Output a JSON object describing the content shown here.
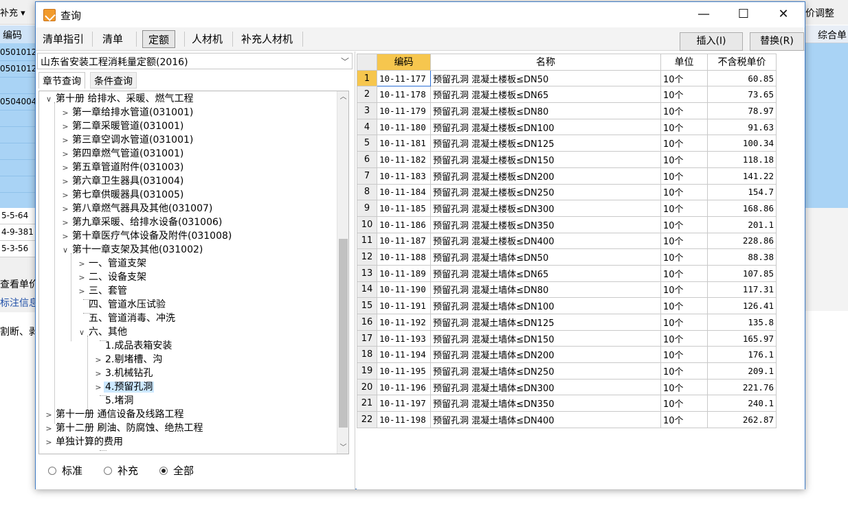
{
  "background": {
    "supplement_menu": "补充 ▾",
    "code_header": "编码",
    "codes": [
      "0501012",
      "0501012",
      "0504004"
    ],
    "white_rows": [
      "5-5-64",
      "4-9-381",
      "5-3-56"
    ],
    "texts": [
      "查看单价",
      "标注信息",
      "割断、剥"
    ],
    "right_label": "价调整",
    "right_header": "综合单"
  },
  "dialog": {
    "title": "查询",
    "window_buttons": {
      "minimize": "—",
      "maximize": "☐",
      "close": "✕"
    },
    "tabs": [
      {
        "label": "清单指引",
        "active": false
      },
      {
        "label": "清单",
        "active": false
      },
      {
        "label": "定额",
        "active": true
      },
      {
        "label": "人材机",
        "active": false
      },
      {
        "label": "补充人材机",
        "active": false
      }
    ],
    "buttons": {
      "insert": "插入(I)",
      "replace": "替换(R)"
    },
    "quota_library": "山东省安装工程消耗量定额(2016)",
    "subtabs": {
      "chapter": "章节查询",
      "condition": "条件查询"
    },
    "tree": [
      {
        "label": "第十册 给排水、采暖、燃气工程",
        "toggle": "expanded"
      },
      {
        "label": "第一章给排水管道(031001)",
        "toggle": "collapsed"
      },
      {
        "label": "第二章采暖管道(031001)",
        "toggle": "collapsed"
      },
      {
        "label": "第三章空调水管道(031001)",
        "toggle": "collapsed"
      },
      {
        "label": "第四章燃气管道(031001)",
        "toggle": "collapsed"
      },
      {
        "label": "第五章管道附件(031003)",
        "toggle": "collapsed"
      },
      {
        "label": "第六章卫生器具(031004)",
        "toggle": "collapsed"
      },
      {
        "label": "第七章供暖器具(031005)",
        "toggle": "collapsed"
      },
      {
        "label": "第八章燃气器具及其他(031007)",
        "toggle": "collapsed"
      },
      {
        "label": "第九章采暖、给排水设备(031006)",
        "toggle": "collapsed"
      },
      {
        "label": "第十章医疗气体设备及附件(031008)",
        "toggle": "collapsed"
      },
      {
        "label": "第十一章支架及其他(031002)",
        "toggle": "expanded"
      },
      {
        "label": "一、管道支架",
        "toggle": "collapsed"
      },
      {
        "label": "二、设备支架",
        "toggle": "collapsed"
      },
      {
        "label": "三、套管",
        "toggle": "collapsed"
      },
      {
        "label": "四、管道水压试验",
        "toggle": "none"
      },
      {
        "label": "五、管道消毒、冲洗",
        "toggle": "none"
      },
      {
        "label": "六、其他",
        "toggle": "expanded"
      },
      {
        "label": "1.成品表箱安装",
        "toggle": "none"
      },
      {
        "label": "2.剔堵槽、沟",
        "toggle": "collapsed"
      },
      {
        "label": "3.机械钻孔",
        "toggle": "collapsed"
      },
      {
        "label": "4.预留孔洞",
        "toggle": "collapsed",
        "selected": true
      },
      {
        "label": "5.堵洞",
        "toggle": "none"
      },
      {
        "label": "第十一册 通信设备及线路工程",
        "toggle": "collapsed"
      },
      {
        "label": "第十二册 刷油、防腐蚀、绝热工程",
        "toggle": "collapsed"
      },
      {
        "label": "单独计算的费用",
        "toggle": "collapsed"
      }
    ],
    "filters": [
      {
        "label": "标准",
        "checked": false
      },
      {
        "label": "补充",
        "checked": false
      },
      {
        "label": "全部",
        "checked": true
      }
    ],
    "table": {
      "columns": [
        "编码",
        "名称",
        "单位",
        "不含税单价"
      ],
      "rows": [
        {
          "no": "1",
          "code": "10-11-177",
          "name": "预留孔洞 混凝土楼板≤DN50",
          "unit": "10个",
          "price": "60.85"
        },
        {
          "no": "2",
          "code": "10-11-178",
          "name": "预留孔洞 混凝土楼板≤DN65",
          "unit": "10个",
          "price": "73.65"
        },
        {
          "no": "3",
          "code": "10-11-179",
          "name": "预留孔洞 混凝土楼板≤DN80",
          "unit": "10个",
          "price": "78.97"
        },
        {
          "no": "4",
          "code": "10-11-180",
          "name": "预留孔洞 混凝土楼板≤DN100",
          "unit": "10个",
          "price": "91.63"
        },
        {
          "no": "5",
          "code": "10-11-181",
          "name": "预留孔洞 混凝土楼板≤DN125",
          "unit": "10个",
          "price": "100.34"
        },
        {
          "no": "6",
          "code": "10-11-182",
          "name": "预留孔洞 混凝土楼板≤DN150",
          "unit": "10个",
          "price": "118.18"
        },
        {
          "no": "7",
          "code": "10-11-183",
          "name": "预留孔洞 混凝土楼板≤DN200",
          "unit": "10个",
          "price": "141.22"
        },
        {
          "no": "8",
          "code": "10-11-184",
          "name": "预留孔洞 混凝土楼板≤DN250",
          "unit": "10个",
          "price": "154.7"
        },
        {
          "no": "9",
          "code": "10-11-185",
          "name": "预留孔洞 混凝土楼板≤DN300",
          "unit": "10个",
          "price": "168.86"
        },
        {
          "no": "10",
          "code": "10-11-186",
          "name": "预留孔洞 混凝土楼板≤DN350",
          "unit": "10个",
          "price": "201.1"
        },
        {
          "no": "11",
          "code": "10-11-187",
          "name": "预留孔洞 混凝土楼板≤DN400",
          "unit": "10个",
          "price": "228.86"
        },
        {
          "no": "12",
          "code": "10-11-188",
          "name": "预留孔洞 混凝土墙体≤DN50",
          "unit": "10个",
          "price": "88.38"
        },
        {
          "no": "13",
          "code": "10-11-189",
          "name": "预留孔洞 混凝土墙体≤DN65",
          "unit": "10个",
          "price": "107.85"
        },
        {
          "no": "14",
          "code": "10-11-190",
          "name": "预留孔洞 混凝土墙体≤DN80",
          "unit": "10个",
          "price": "117.31"
        },
        {
          "no": "15",
          "code": "10-11-191",
          "name": "预留孔洞 混凝土墙体≤DN100",
          "unit": "10个",
          "price": "126.41"
        },
        {
          "no": "16",
          "code": "10-11-192",
          "name": "预留孔洞 混凝土墙体≤DN125",
          "unit": "10个",
          "price": "135.8"
        },
        {
          "no": "17",
          "code": "10-11-193",
          "name": "预留孔洞 混凝土墙体≤DN150",
          "unit": "10个",
          "price": "165.97"
        },
        {
          "no": "18",
          "code": "10-11-194",
          "name": "预留孔洞 混凝土墙体≤DN200",
          "unit": "10个",
          "price": "176.1"
        },
        {
          "no": "19",
          "code": "10-11-195",
          "name": "预留孔洞 混凝土墙体≤DN250",
          "unit": "10个",
          "price": "209.1"
        },
        {
          "no": "20",
          "code": "10-11-196",
          "name": "预留孔洞 混凝土墙体≤DN300",
          "unit": "10个",
          "price": "221.76"
        },
        {
          "no": "21",
          "code": "10-11-197",
          "name": "预留孔洞 混凝土墙体≤DN350",
          "unit": "10个",
          "price": "240.1"
        },
        {
          "no": "22",
          "code": "10-11-198",
          "name": "预留孔洞 混凝土墙体≤DN400",
          "unit": "10个",
          "price": "262.87"
        }
      ]
    }
  },
  "colors": {
    "accent_header": "#f6c64e",
    "selection": "#cce8ff",
    "background_grid_blue": "#a9d3f5",
    "dialog_border": "#3d7ac4"
  }
}
